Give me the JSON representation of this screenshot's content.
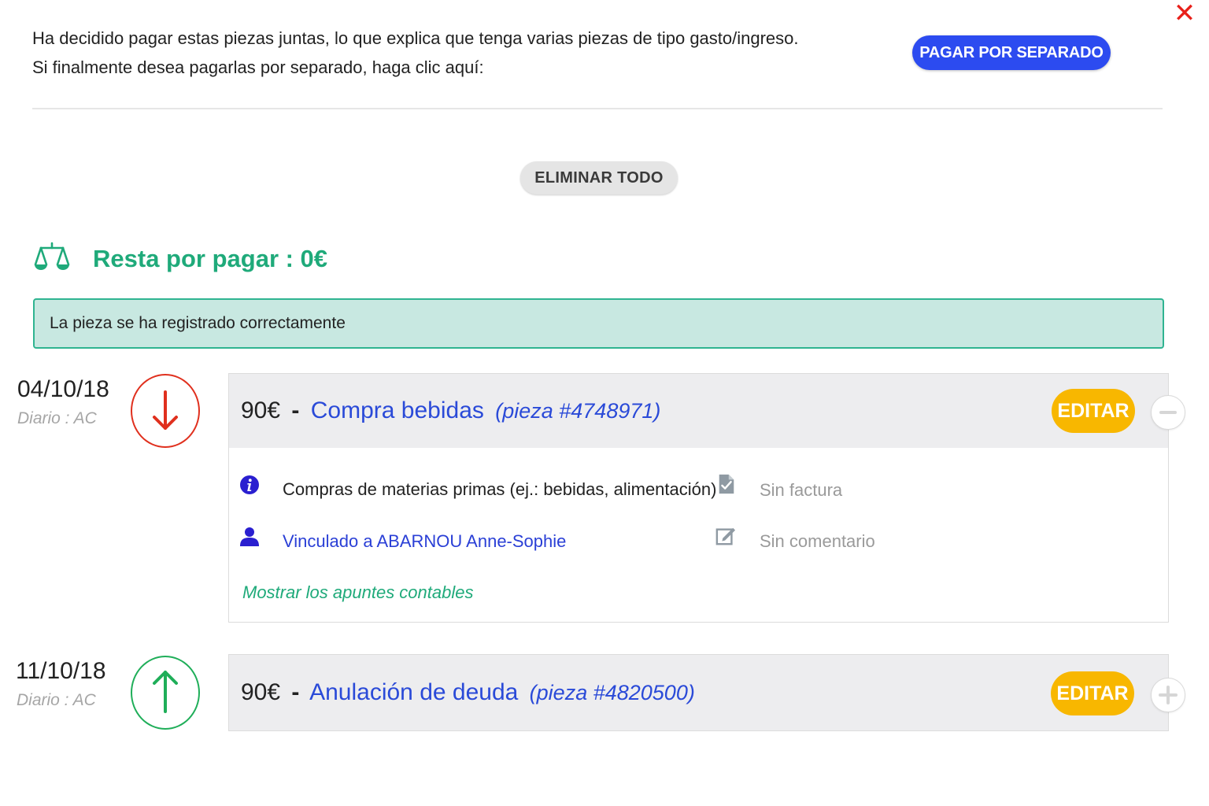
{
  "dialog": {
    "close_icon": "close-icon",
    "close_color": "#e8201a"
  },
  "notice": {
    "line1": "Ha decidido pagar estas piezas juntas, lo que explica que tenga varias piezas de tipo gasto/ingreso.",
    "line2": "Si finalmente desea pagarlas por separado, haga clic aquí:",
    "pay_separately_label": "PAGAR POR SEPARADO"
  },
  "actions": {
    "delete_all_label": "ELIMINAR TODO"
  },
  "balance": {
    "icon": "balance-scale-icon",
    "text": "Resta por pagar : 0€",
    "color": "#1faa7a"
  },
  "alert": {
    "text": "La pieza se ha registrado correctamente"
  },
  "entries": [
    {
      "date": "04/10/18",
      "journal": "Diario : AC",
      "direction": "down",
      "direction_icon": "arrow-down-icon",
      "amount": "90€",
      "separator": "-",
      "label": "Compra bebidas",
      "ref": "(pieza #4748971)",
      "edit_label": "EDITAR",
      "toggle_icon": "minus-icon",
      "expanded": true,
      "details": {
        "category": "Compras de materias primas (ej.: bebidas, alimentación)",
        "linked": "Vinculado a ABARNOU Anne-Sophie",
        "invoice": "Sin factura",
        "comment": "Sin comentario",
        "show_entries": "Mostrar los apuntes contables"
      }
    },
    {
      "date": "11/10/18",
      "journal": "Diario : AC",
      "direction": "up",
      "direction_icon": "arrow-up-icon",
      "amount": "90€",
      "separator": "-",
      "label": "Anulación de deuda",
      "ref": "(pieza #4820500)",
      "edit_label": "EDITAR",
      "toggle_icon": "plus-icon",
      "expanded": false
    }
  ],
  "colors": {
    "primary_button": "#2c4bf0",
    "edit_button": "#f8b700",
    "link": "#2a4ad8",
    "success": "#1faa7a",
    "expense_arrow": "#e0301e",
    "income_arrow": "#1fae59"
  }
}
